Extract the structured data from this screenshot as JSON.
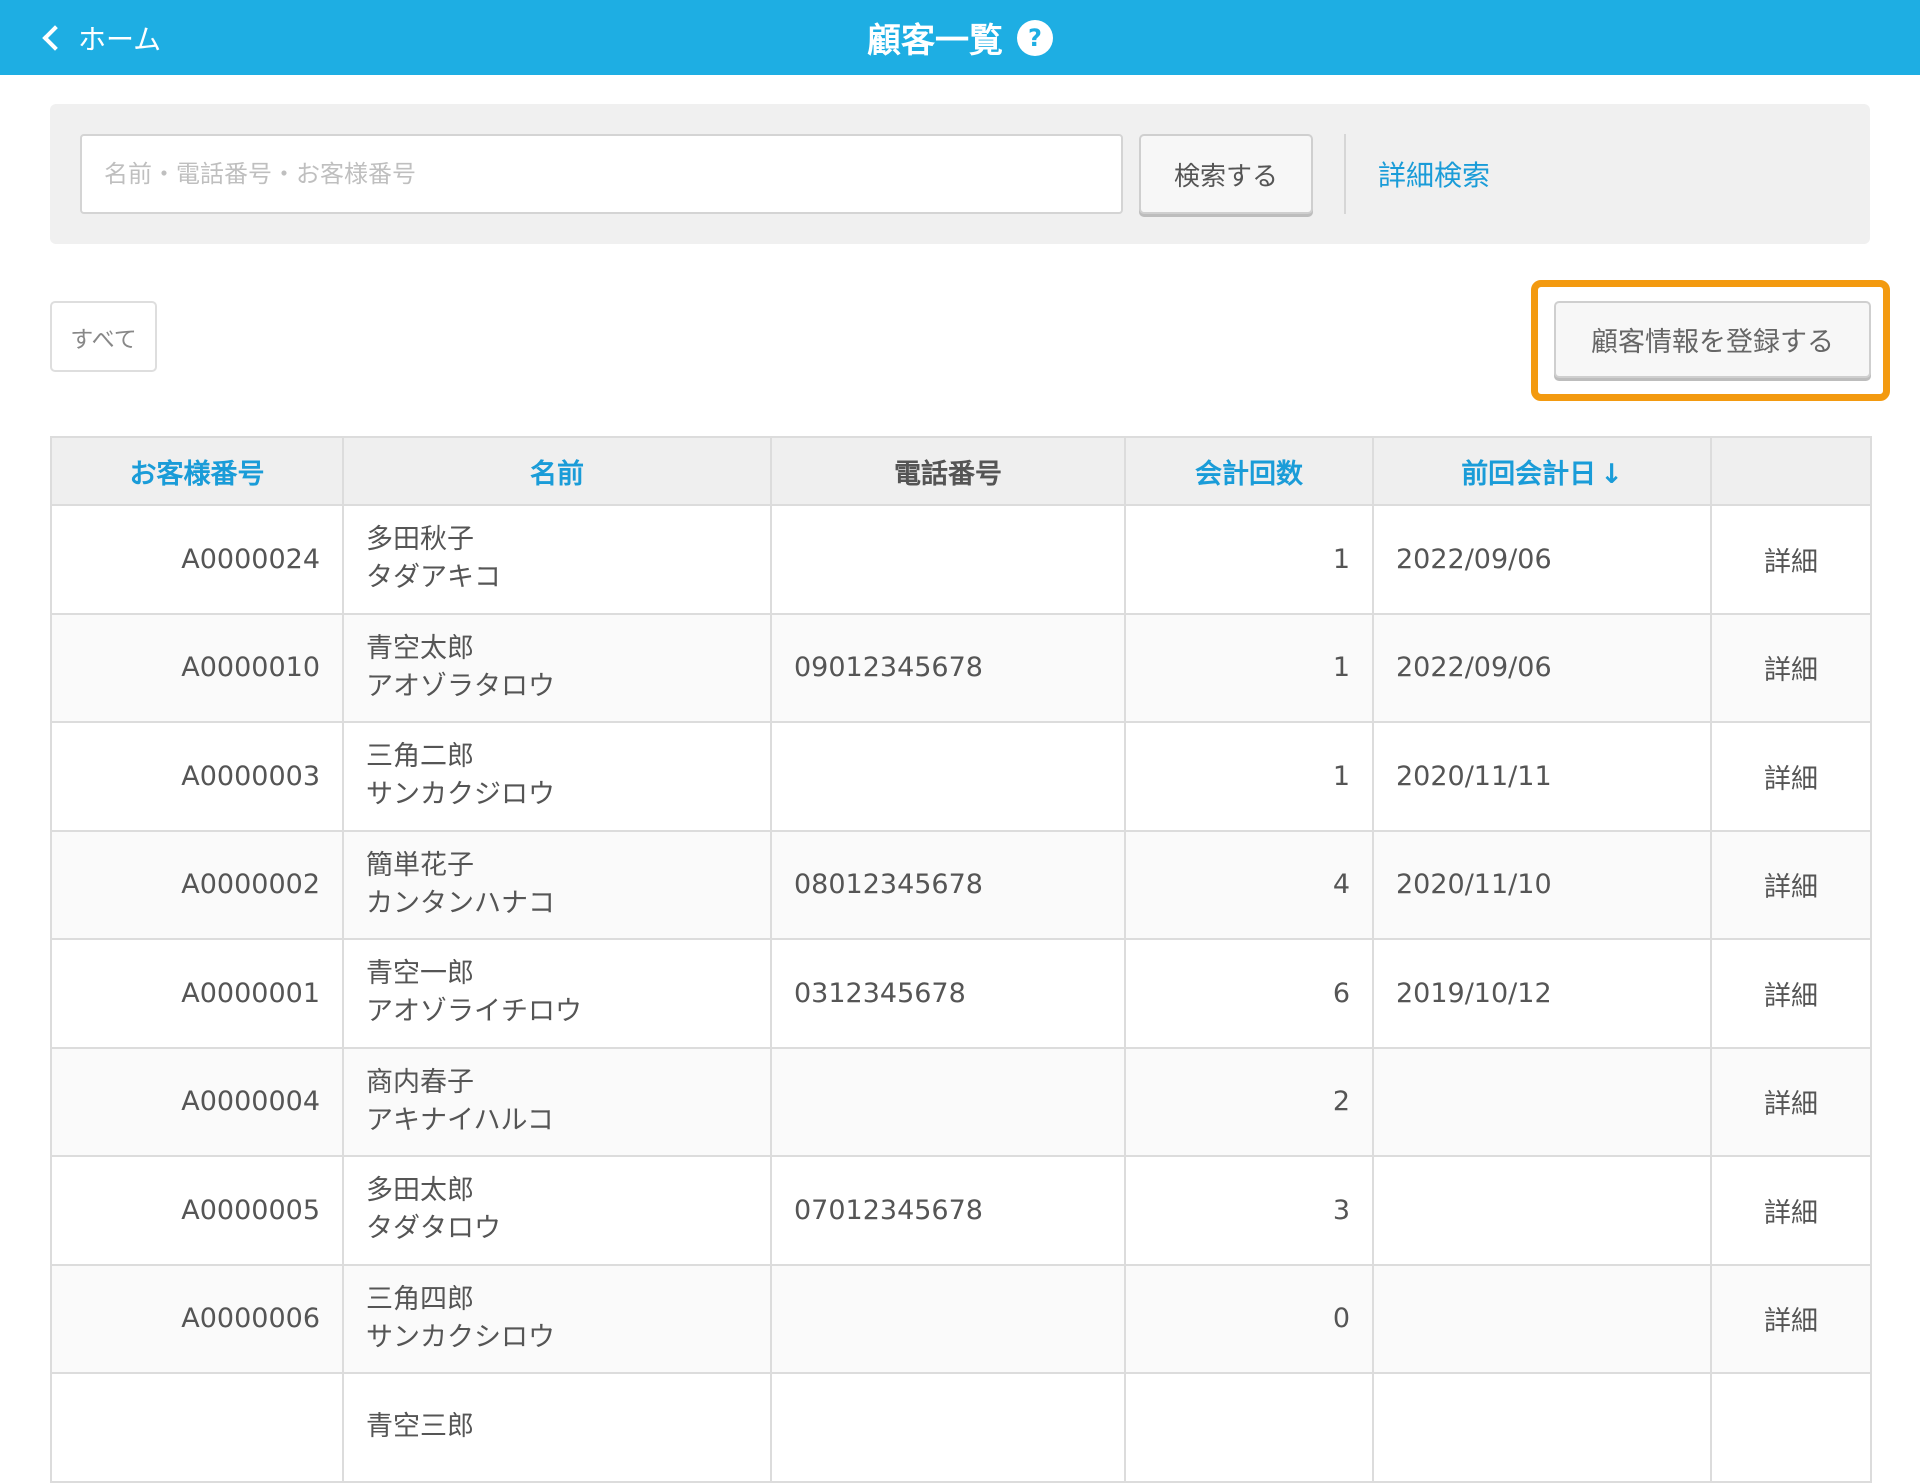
{
  "colors": {
    "accent": "#1eaee3",
    "link": "#1a9cd8",
    "highlight": "#f39a10"
  },
  "header": {
    "back_label": "ホーム",
    "back_icon": "chevron-left-icon",
    "title": "顧客一覧",
    "help_glyph": "?"
  },
  "search": {
    "placeholder": "名前・電話番号・お客様番号",
    "value": "",
    "button_label": "検索する",
    "advanced_label": "詳細検索"
  },
  "filter": {
    "all_label": "すべて"
  },
  "register": {
    "label": "顧客情報を登録する"
  },
  "table": {
    "headers": {
      "id": "お客様番号",
      "name": "名前",
      "phone": "電話番号",
      "count": "会計回数",
      "last_date": "前回会計日",
      "sort_glyph": "↓"
    },
    "detail_label": "詳細",
    "rows": [
      {
        "id": "A0000024",
        "name": "多田秋子",
        "kana": "タダアキコ",
        "phone": "",
        "count": "1",
        "last_date": "2022/09/06"
      },
      {
        "id": "A0000010",
        "name": "青空太郎",
        "kana": "アオゾラタロウ",
        "phone": "09012345678",
        "count": "1",
        "last_date": "2022/09/06"
      },
      {
        "id": "A0000003",
        "name": "三角二郎",
        "kana": "サンカクジロウ",
        "phone": "",
        "count": "1",
        "last_date": "2020/11/11"
      },
      {
        "id": "A0000002",
        "name": "簡単花子",
        "kana": "カンタンハナコ",
        "phone": "08012345678",
        "count": "4",
        "last_date": "2020/11/10"
      },
      {
        "id": "A0000001",
        "name": "青空一郎",
        "kana": "アオゾライチロウ",
        "phone": "0312345678",
        "count": "6",
        "last_date": "2019/10/12"
      },
      {
        "id": "A0000004",
        "name": "商内春子",
        "kana": "アキナイハルコ",
        "phone": "",
        "count": "2",
        "last_date": ""
      },
      {
        "id": "A0000005",
        "name": "多田太郎",
        "kana": "タダタロウ",
        "phone": "07012345678",
        "count": "3",
        "last_date": ""
      },
      {
        "id": "A0000006",
        "name": "三角四郎",
        "kana": "サンカクシロウ",
        "phone": "",
        "count": "0",
        "last_date": ""
      },
      {
        "id": "",
        "name": "青空三郎",
        "kana": "",
        "phone": "",
        "count": "",
        "last_date": ""
      }
    ]
  }
}
